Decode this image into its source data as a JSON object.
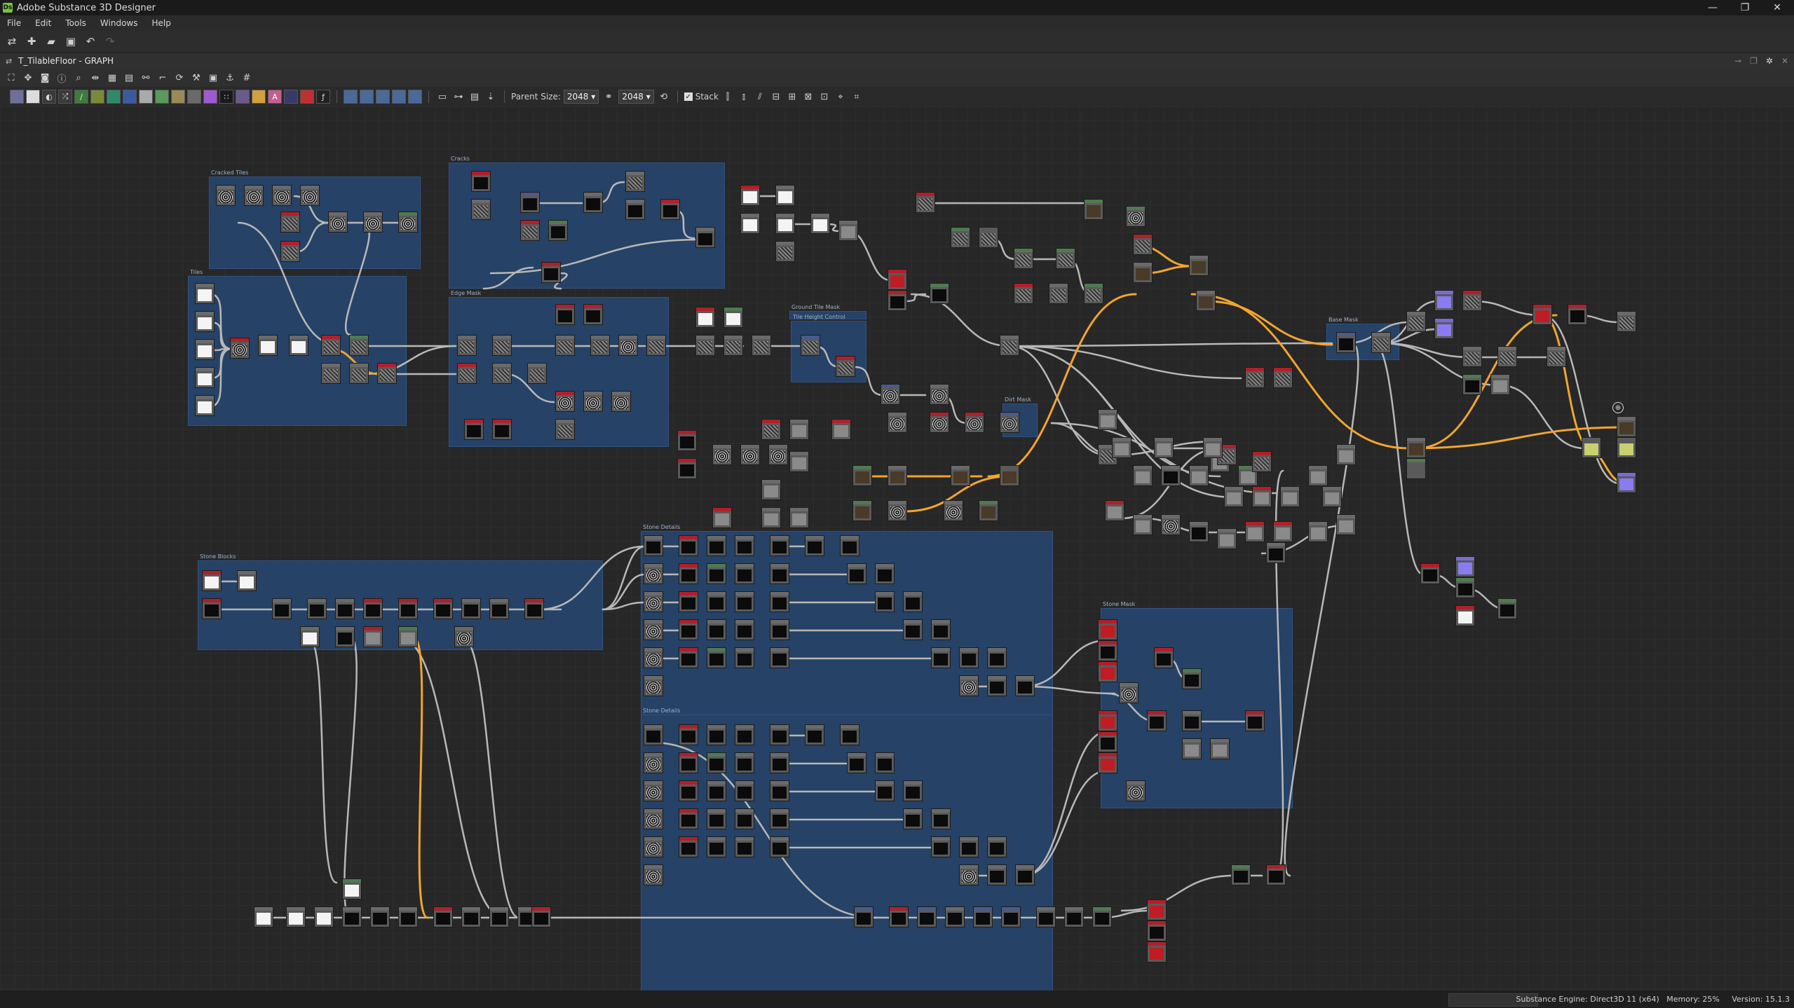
{
  "window": {
    "title": "Adobe Substance 3D Designer",
    "app_icon_text": "Ds",
    "minimize": "—",
    "maximize": "❐",
    "close": "✕"
  },
  "menu": [
    "File",
    "Edit",
    "Tools",
    "Windows",
    "Help"
  ],
  "main_toolbar": {
    "icons": [
      "share-icon",
      "new-graph-icon",
      "open-folder-icon",
      "save-icon",
      "undo-icon",
      "redo-icon"
    ]
  },
  "graph_tab": {
    "title": "T_TilableFloor - GRAPH"
  },
  "graph_toolbar": {
    "parent_size_label": "Parent Size:",
    "parent_size_value": "2048",
    "size_value": "2048",
    "stack_label": "Stack",
    "stack_checked": true
  },
  "node_colors": {
    "header_default": "#6a6a6a",
    "header_green": "#4f7a52",
    "header_red": "#b0202a",
    "header_purple": "#7a6ad8",
    "header_blue": "#4a5a8a",
    "frame_fill": "#264266",
    "wire_gray": "#b8b8b8",
    "wire_orange": "#f2a52e"
  },
  "frames": [
    {
      "title": "Cracked Tiles"
    },
    {
      "title": "Cracks"
    },
    {
      "title": "Tiles"
    },
    {
      "title": "Edge Mask"
    },
    {
      "title": "Ground Tile Mask"
    },
    {
      "title": "Tile Height Control"
    },
    {
      "title": "Dirt Mask"
    },
    {
      "title": "Base Mask"
    },
    {
      "title": "Stone Blocks"
    },
    {
      "title": "Stone Details"
    },
    {
      "title": "Stone Details"
    },
    {
      "title": "Stone Mask"
    }
  ],
  "status": {
    "engine": "Substance Engine: Direct3D 11 (x64)",
    "memory": "Memory: 25%",
    "version": "Version: 15.1.3"
  }
}
